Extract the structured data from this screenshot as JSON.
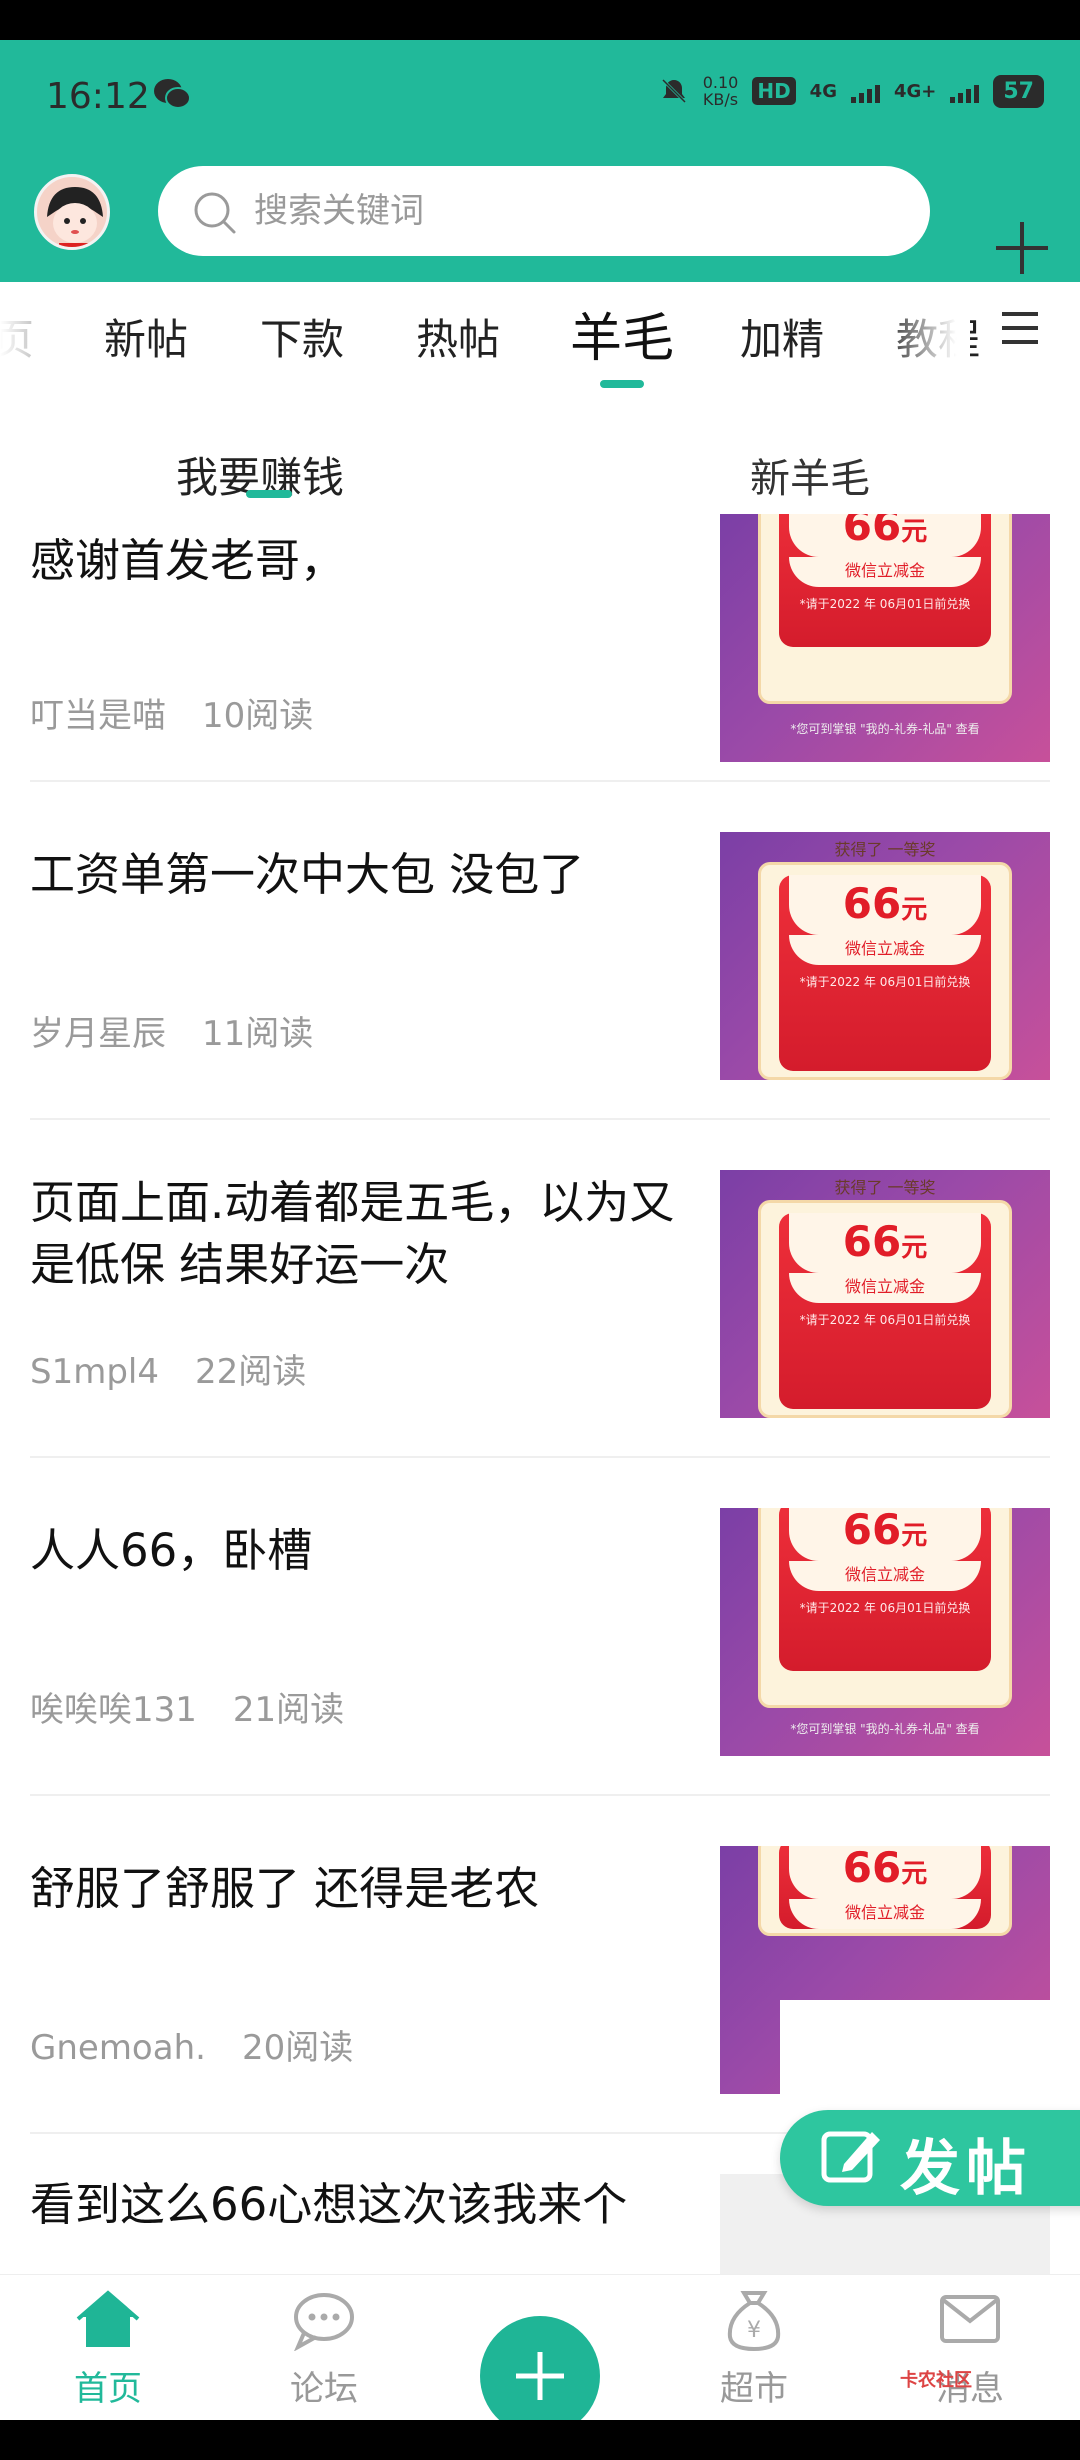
{
  "status_bar": {
    "time": "16:12",
    "speed_top": "0.10",
    "speed_bottom": "KB/s",
    "hd": "HD",
    "net1": "4G",
    "net2": "4G+",
    "battery": "57"
  },
  "search": {
    "placeholder": "搜索关键词"
  },
  "categories": {
    "items": [
      "页",
      "新帖",
      "下款",
      "热帖",
      "羊毛",
      "加精",
      "教程"
    ],
    "active": "羊毛"
  },
  "subtabs": {
    "left": "我要赚钱",
    "right": "新羊毛"
  },
  "posts": [
    {
      "title": "感谢首发老哥，",
      "author": "叮当是喵",
      "reads": "10阅读"
    },
    {
      "title": "工资单第一次中大包 没包了",
      "author": "岁月星辰",
      "reads": "11阅读"
    },
    {
      "title": "页面上面.动着都是五毛，以为又是低保 结果好运一次",
      "author": "S1mpl4",
      "reads": "22阅读"
    },
    {
      "title": "人人66，卧槽",
      "author": "唉唉唉131",
      "reads": "21阅读"
    },
    {
      "title": "舒服了舒服了 还得是老农",
      "author": "Gnemoah.",
      "reads": "20阅读"
    },
    {
      "title": "看到这么66心想这次该我来个",
      "author": "",
      "reads": ""
    }
  ],
  "coupon": {
    "award": "获得了 一等奖",
    "amount": "66",
    "unit": "元",
    "label": "微信立减金",
    "expiry": "*请于2022 年 06月01日前兑换",
    "note": "*您可到掌银 \"我的-礼券-礼品\" 查看"
  },
  "fab": {
    "label": "发帖"
  },
  "bottom_nav": {
    "home": "首页",
    "forum": "论坛",
    "market": "超市",
    "messages": "消息"
  },
  "watermark": "卡农社区",
  "colors": {
    "accent": "#21b99a",
    "fab": "#2ec69f"
  }
}
